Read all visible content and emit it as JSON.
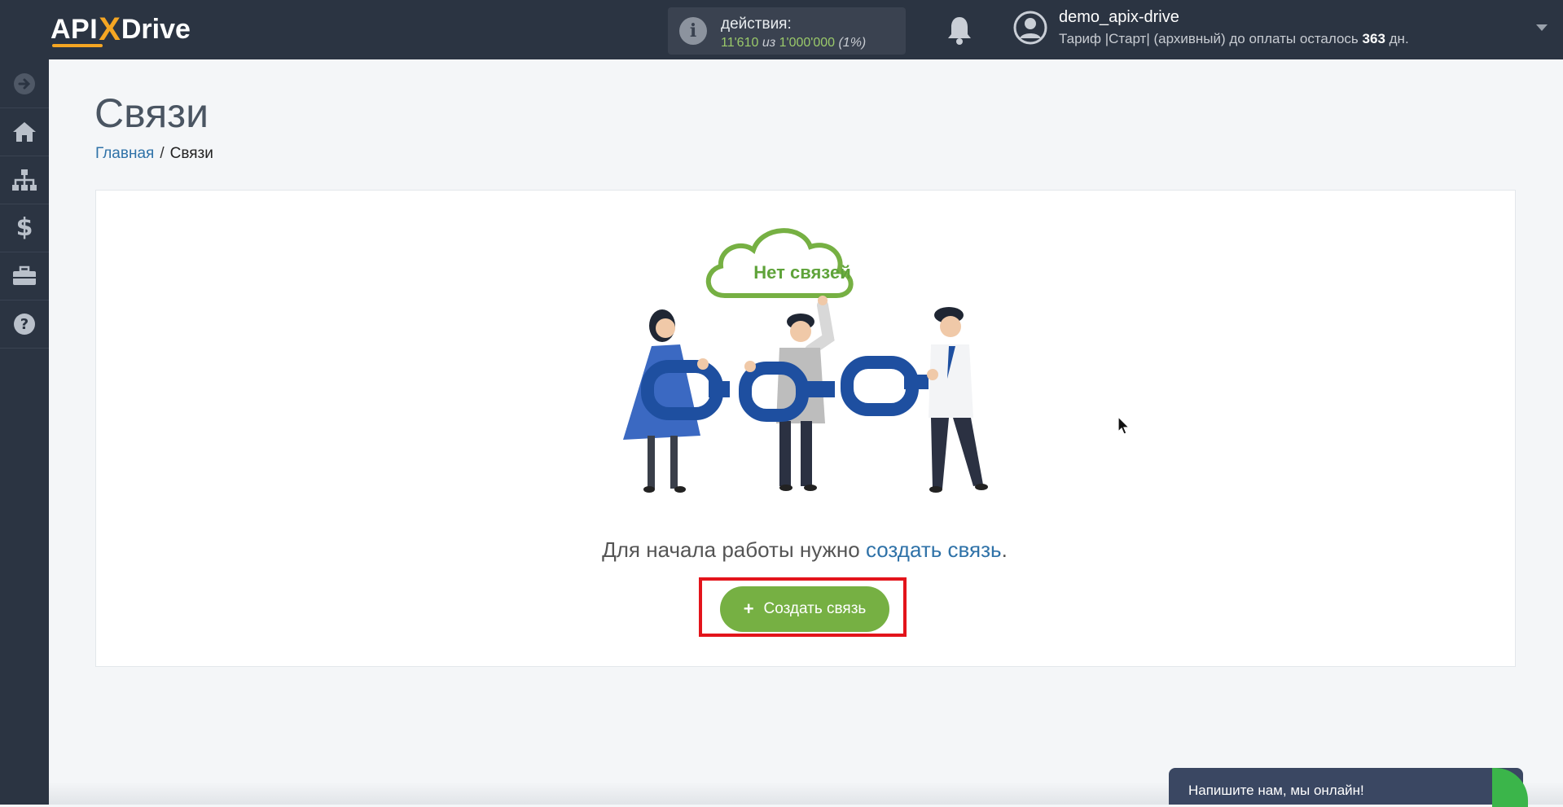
{
  "header": {
    "logo": {
      "api": "API",
      "x": "X",
      "drive": "Drive"
    },
    "actions": {
      "label": "действия:",
      "used": "11'610",
      "of": "из",
      "total": "1'000'000",
      "percent": "(1%)"
    },
    "user": {
      "name": "demo_apix-drive",
      "tariff_prefix": "Тариф |Старт| (архивный) до оплаты осталось",
      "days": "363",
      "days_suffix": "дн."
    }
  },
  "sidebar": {
    "items": [
      {
        "icon": "arrow-right-circle-icon"
      },
      {
        "icon": "home-icon"
      },
      {
        "icon": "sitemap-icon"
      },
      {
        "icon": "dollar-icon"
      },
      {
        "icon": "briefcase-icon"
      },
      {
        "icon": "help-icon"
      }
    ]
  },
  "page": {
    "title": "Связи",
    "breadcrumb": {
      "home": "Главная",
      "separator": "/",
      "current": "Связи"
    }
  },
  "empty_state": {
    "cloud_text": "Нет связей",
    "message_prefix": "Для начала работы нужно",
    "message_link": "создать связь",
    "message_suffix": ".",
    "button_icon": "+",
    "button_label": "Создать связь"
  },
  "chat": {
    "label": "Напишите нам, мы онлайн!"
  },
  "colors": {
    "topbar": "#2b3442",
    "accent_green": "#76b043",
    "link_blue": "#2f72a8",
    "highlight_red": "#e3141b",
    "chain_blue": "#1e4fa0"
  }
}
